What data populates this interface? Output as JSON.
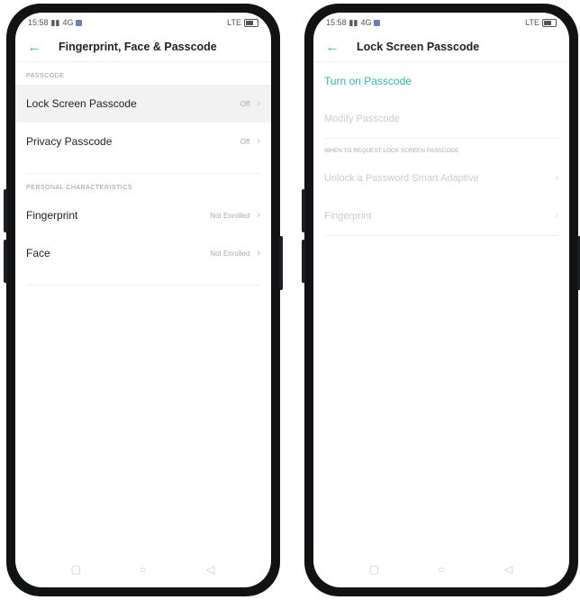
{
  "left": {
    "status": {
      "time": "15:58",
      "net": "4G",
      "right": "LTE"
    },
    "appbar": {
      "title": "Fingerprint, Face & Passcode"
    },
    "passcode_section": "PASSCODE",
    "rows": [
      {
        "label": "Lock Screen Passcode",
        "value": "Off"
      },
      {
        "label": "Privacy Passcode",
        "value": "Off"
      }
    ],
    "personal_section": "PERSONAL CHARACTERISTICS",
    "bio_rows": [
      {
        "label": "Fingerprint",
        "value": "Not Enrolled"
      },
      {
        "label": "Face",
        "value": "Not Enrolled"
      }
    ]
  },
  "right": {
    "status": {
      "time": "15:58",
      "net": "4G",
      "right": "LTE"
    },
    "appbar": {
      "title": "Lock Screen Passcode"
    },
    "turn_on": "Turn on Passcode",
    "change": "Modify Passcode",
    "section": "WHEN TO REQUEST LOCK SCREEN PASSCODE",
    "rows": [
      {
        "label": "Unlock a Password Smart Adaptive"
      },
      {
        "label": "Fingerprint"
      }
    ]
  },
  "icons": {
    "back": "back-arrow-icon",
    "chevron": "chevron-right-icon",
    "nav": [
      "recent-apps-icon",
      "home-icon",
      "back-triangle-icon"
    ]
  },
  "colors": {
    "accent": "#2fb6a4"
  }
}
